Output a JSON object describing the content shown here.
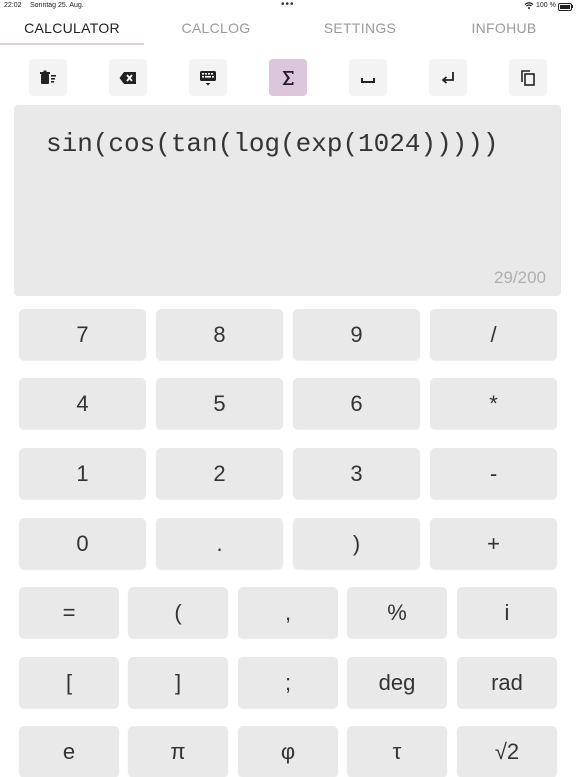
{
  "status_bar": {
    "time": "22:02",
    "date": "Sonntag 25. Aug.",
    "dots": "•••",
    "battery_percent": "100 %"
  },
  "tabs": [
    {
      "label": "CALCULATOR",
      "active": true
    },
    {
      "label": "CALCLOG",
      "active": false
    },
    {
      "label": "SETTINGS",
      "active": false
    },
    {
      "label": "INFOHUB",
      "active": false
    }
  ],
  "toolbar": {
    "items": [
      {
        "icon": "clear-all-icon"
      },
      {
        "icon": "backspace-icon"
      },
      {
        "icon": "keyboard-icon"
      },
      {
        "icon": "sigma-icon",
        "active": true
      },
      {
        "icon": "space-icon"
      },
      {
        "icon": "enter-icon"
      },
      {
        "icon": "copy-icon"
      }
    ],
    "active_color": "#dcc6dc"
  },
  "display": {
    "expression": "sin(cos(tan(log(exp(1024)))))",
    "counter": "29/200"
  },
  "keypad": {
    "rows": [
      [
        "7",
        "8",
        "9",
        "/"
      ],
      [
        "4",
        "5",
        "6",
        "*"
      ],
      [
        "1",
        "2",
        "3",
        "-"
      ],
      [
        "0",
        ".",
        ")",
        "+"
      ],
      [
        "=",
        "(",
        ",",
        "%",
        "i"
      ],
      [
        "[",
        "]",
        ";",
        "deg",
        "rad"
      ],
      [
        "e",
        "π",
        "φ",
        "τ",
        "√2"
      ]
    ]
  }
}
